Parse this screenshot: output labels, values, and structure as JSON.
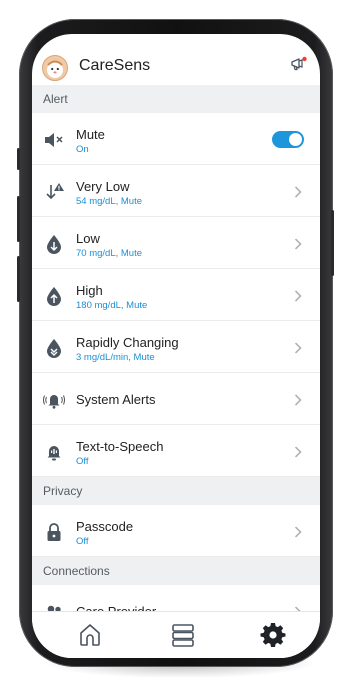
{
  "app": {
    "title": "CareSens"
  },
  "sections": {
    "alert": "Alert",
    "privacy": "Privacy",
    "connections": "Connections"
  },
  "alert_rows": [
    {
      "label": "Mute",
      "sub": "On",
      "icon": "speaker-mute-icon",
      "control": "toggle",
      "on": true
    },
    {
      "label": "Very Low",
      "sub": "54 mg/dL, Mute",
      "icon": "down-arrow-warning-icon"
    },
    {
      "label": "Low",
      "sub": "70 mg/dL, Mute",
      "icon": "drop-down-arrow-icon"
    },
    {
      "label": "High",
      "sub": "180 mg/dL, Mute",
      "icon": "drop-up-arrow-icon"
    },
    {
      "label": "Rapidly Changing",
      "sub": "3 mg/dL/min, Mute",
      "icon": "drop-double-arrow-icon"
    },
    {
      "label": "System Alerts",
      "icon": "bell-ringing-icon"
    },
    {
      "label": "Text-to-Speech",
      "sub": "Off",
      "icon": "speech-bell-icon"
    }
  ],
  "privacy_rows": [
    {
      "label": "Passcode",
      "sub": "Off",
      "icon": "lock-icon"
    }
  ],
  "connection_rows": [
    {
      "label": "Care Provider",
      "icon": "people-icon"
    }
  ],
  "colors": {
    "accent": "#1e96dc",
    "section_bg": "#eef0f2",
    "icon": "#4a5560"
  }
}
